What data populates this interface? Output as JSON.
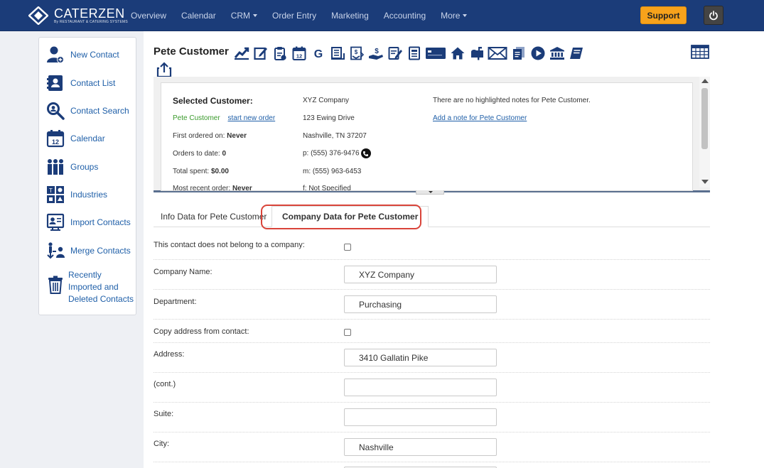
{
  "app": {
    "logo_name": "CATERZEN",
    "logo_tagline": "By RESTAURANT & CATERING SYSTEMS"
  },
  "nav": {
    "items": [
      {
        "label": "Overview",
        "dropdown": false
      },
      {
        "label": "Calendar",
        "dropdown": false
      },
      {
        "label": "CRM",
        "dropdown": true
      },
      {
        "label": "Order Entry",
        "dropdown": false
      },
      {
        "label": "Marketing",
        "dropdown": false
      },
      {
        "label": "Accounting",
        "dropdown": false
      },
      {
        "label": "More",
        "dropdown": true
      }
    ],
    "support_label": "Support",
    "power_icon": "power-icon"
  },
  "sidebar": {
    "items": [
      {
        "label": "New Contact",
        "icon": "new-contact-icon"
      },
      {
        "label": "Contact List",
        "icon": "contact-list-icon"
      },
      {
        "label": "Contact Search",
        "icon": "search-icon"
      },
      {
        "label": "Calendar",
        "icon": "calendar-icon"
      },
      {
        "label": "Groups",
        "icon": "groups-icon"
      },
      {
        "label": "Industries",
        "icon": "industries-icon"
      },
      {
        "label": "Import Contacts",
        "icon": "import-icon"
      },
      {
        "label": "Merge Contacts",
        "icon": "merge-icon"
      },
      {
        "label": "Recently Imported and Deleted Contacts",
        "icon": "trash-icon"
      }
    ]
  },
  "customer": {
    "name": "Pete Customer",
    "selected_label": "Selected Customer:",
    "start_new_order": "start new order",
    "first_ordered_label": "First ordered on:",
    "first_ordered_value": "Never",
    "orders_label": "Orders to date:",
    "orders_value": "0",
    "spent_label": "Total spent:",
    "spent_value": "$0.00",
    "recent_label": "Most recent order:",
    "recent_value": "Never",
    "company": "XYZ Company",
    "address1": "123 Ewing Drive",
    "address2": "Nashville, TN 37207",
    "phone": "p: (555) 376-9476",
    "mobile": "m: (555) 963-6453",
    "fax": "f: Not Specified",
    "notes_text": "There are no highlighted notes for Pete Customer.",
    "add_note_link": "Add a note for Pete Customer"
  },
  "toolbar_icons": [
    "trend-chart-icon",
    "edit-note-icon",
    "clipboard-icon",
    "calendar-12-icon",
    "google-icon",
    "ledger-icon",
    "money-doc-icon",
    "payment-hand-icon",
    "form-edit-icon",
    "document-icon",
    "credit-card-icon",
    "home-icon",
    "mailbox-icon",
    "envelope-icon",
    "pages-icon",
    "play-icon",
    "bank-icon",
    "book-icon"
  ],
  "tabs": {
    "info": "Info Data for Pete Customer",
    "company": "Company Data for Pete Customer",
    "active": "company"
  },
  "form": {
    "no_company_label": "This contact does not belong to a company:",
    "company_name_label": "Company Name:",
    "company_name_value": "XYZ Company",
    "department_label": "Department:",
    "department_value": "Purchasing",
    "copy_address_label": "Copy address from contact:",
    "address_label": "Address:",
    "address_value": "3410 Gallatin Pike",
    "cont_label": "(cont.)",
    "cont_value": "",
    "suite_label": "Suite:",
    "suite_value": "",
    "city_label": "City:",
    "city_value": "Nashville"
  },
  "colors": {
    "navbar": "#1b3c79",
    "support": "#f7a21b",
    "link": "#1f5fa8",
    "customer_green": "#3a9a2c",
    "highlight": "#d9443a"
  }
}
